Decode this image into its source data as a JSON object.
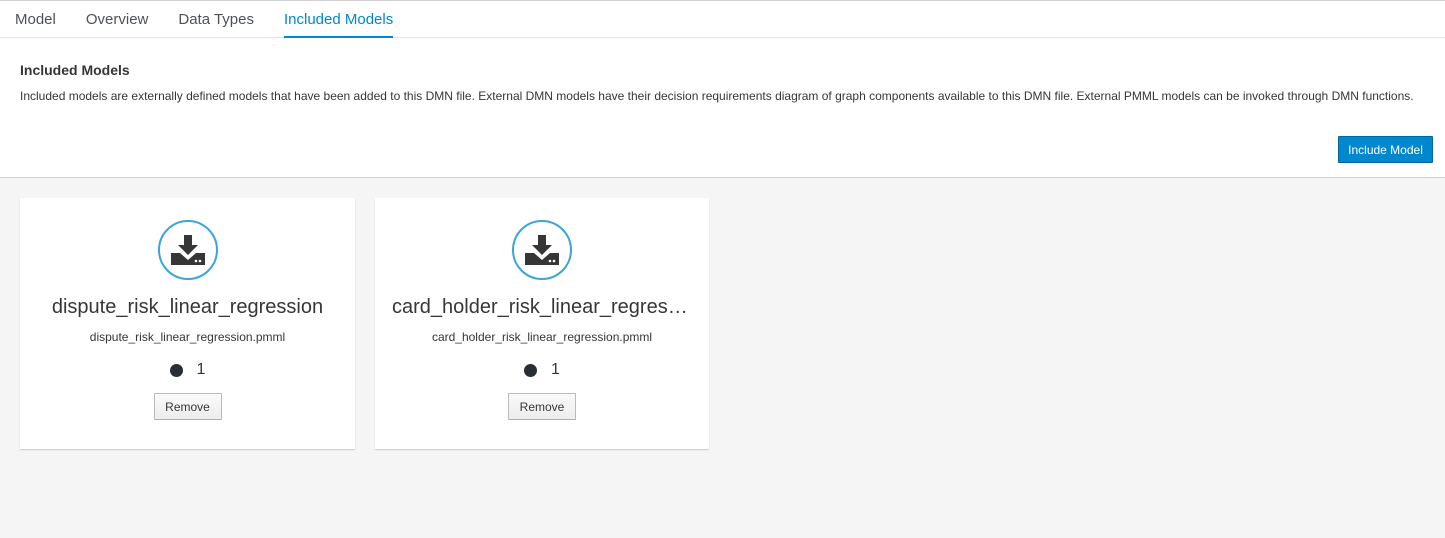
{
  "tabs": [
    {
      "label": "Model"
    },
    {
      "label": "Overview"
    },
    {
      "label": "Data Types"
    },
    {
      "label": "Included Models",
      "active": true
    }
  ],
  "header": {
    "title": "Included Models",
    "description": "Included models are externally defined models that have been added to this DMN file. External DMN models have their decision requirements diagram of graph components available to this DMN file. External PMML models can be invoked through DMN functions.",
    "include_button": "Include Model"
  },
  "cards": [
    {
      "icon": "download-icon",
      "title": "dispute_risk_linear_regression",
      "file": "dispute_risk_linear_regression.pmml",
      "count": "1",
      "remove_label": "Remove"
    },
    {
      "icon": "download-icon",
      "title": "card_holder_risk_linear_regression",
      "file": "card_holder_risk_linear_regression.pmml",
      "count": "1",
      "remove_label": "Remove"
    }
  ],
  "colors": {
    "accent": "#0088ce",
    "icon_ring": "#39a5dc",
    "background": "#f5f5f5"
  }
}
